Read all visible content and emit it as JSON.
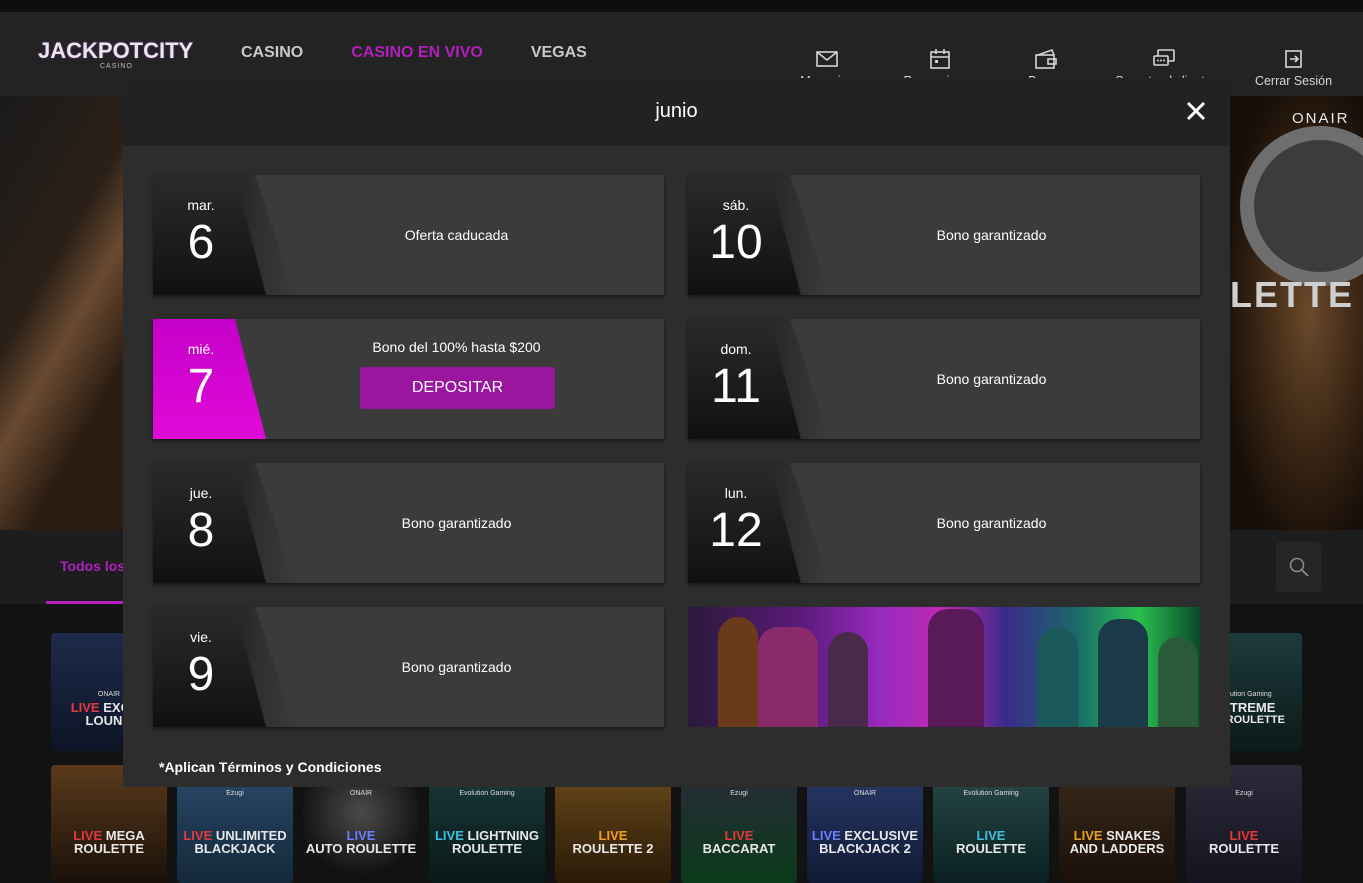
{
  "header": {
    "logo_text": "JACKPOTCITY",
    "logo_sub": "CASINO",
    "nav": [
      {
        "label": "CASINO",
        "active": false
      },
      {
        "label": "CASINO EN VIVO",
        "active": true
      },
      {
        "label": "VEGAS",
        "active": false
      }
    ],
    "actions": [
      {
        "label": "Mensajes",
        "icon": "envelope-icon"
      },
      {
        "label": "Promociones",
        "icon": "calendar-icon"
      },
      {
        "label": "Banca",
        "icon": "wallet-icon"
      },
      {
        "label": "Soporte al cliente",
        "icon": "chat-icon"
      },
      {
        "label": "Cerrar Sesión",
        "icon": "logout-icon"
      }
    ]
  },
  "hero": {
    "onair": "ONAIR",
    "title_fragment": "LETTE"
  },
  "filter": {
    "tab_label": "Todos los",
    "search_icon": "search-icon"
  },
  "games": [
    {
      "line1": "EXCLU",
      "line2": "LOUNG",
      "live": "LIVE",
      "brand": "ONAIR"
    },
    {
      "line1": "XXTREME",
      "line2": "ING ROULETTE",
      "live": "",
      "brand": "Evolution Gaming"
    },
    {
      "line1": "MEGA",
      "line2": "ROULETTE",
      "live": "LIVE",
      "brand": ""
    },
    {
      "line1": "UNLIMITED",
      "line2": "BLACKJACK",
      "live": "LIVE",
      "brand": "Ezugi"
    },
    {
      "line1": "",
      "line2": "AUTO ROULETTE",
      "live": "LIVE",
      "brand": "ONAIR"
    },
    {
      "line1": "LIGHTNING",
      "line2": "ROULETTE",
      "live": "LIVE",
      "brand": "Evolution Gaming"
    },
    {
      "line1": "",
      "line2": "ROULETTE 2",
      "live": "LIVE",
      "brand": ""
    },
    {
      "line1": "",
      "line2": "BACCARAT",
      "live": "LIVE",
      "brand": "Ezugi"
    },
    {
      "line1": "EXCLUSIVE",
      "line2": "BLACKJACK 2",
      "live": "LIVE",
      "brand": "ONAIR"
    },
    {
      "line1": "",
      "line2": "ROULETTE",
      "live": "LIVE",
      "brand": "Evolution Gaming"
    },
    {
      "line1": "SNAKES",
      "line2": "AND LADDERS",
      "live": "LIVE",
      "brand": ""
    },
    {
      "line1": "",
      "line2": "ROULETTE",
      "live": "LIVE",
      "brand": "Ezugi"
    }
  ],
  "modal": {
    "title": "junio",
    "close_icon": "close-icon",
    "terms": "*Aplican Términos y Condiciones",
    "days": [
      {
        "dow": "mar.",
        "num": "6",
        "message": "Oferta caducada",
        "active": false
      },
      {
        "dow": "mié.",
        "num": "7",
        "message": "Bono del 100% hasta $200",
        "button": "DEPOSITAR",
        "active": true
      },
      {
        "dow": "jue.",
        "num": "8",
        "message": "Bono garantizado",
        "active": false
      },
      {
        "dow": "vie.",
        "num": "9",
        "message": "Bono garantizado",
        "active": false
      },
      {
        "dow": "sáb.",
        "num": "10",
        "message": "Bono garantizado",
        "active": false
      },
      {
        "dow": "dom.",
        "num": "11",
        "message": "Bono garantizado",
        "active": false
      },
      {
        "dow": "lun.",
        "num": "12",
        "message": "Bono garantizado",
        "active": false
      }
    ]
  },
  "colors": {
    "accent": "#b21fbd",
    "active_day": "#d900d4",
    "deposit_button": "#9b169e"
  }
}
